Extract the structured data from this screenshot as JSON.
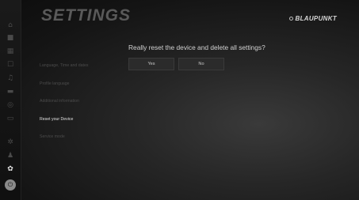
{
  "header": {
    "title": "SETTINGS",
    "brand": "BLAUPUNKT"
  },
  "sidebar": {
    "icons": [
      {
        "name": "home-icon",
        "glyph": "⌂",
        "active": false
      },
      {
        "name": "apps-icon",
        "glyph": "■",
        "active": false
      },
      {
        "name": "grid-icon",
        "glyph": "▦",
        "active": false
      },
      {
        "name": "phone-icon",
        "glyph": "☐",
        "active": false
      },
      {
        "name": "music-icon",
        "glyph": "♫",
        "active": false
      },
      {
        "name": "car-icon",
        "glyph": "▬",
        "active": false
      },
      {
        "name": "navigation-icon",
        "glyph": "◎",
        "active": false
      },
      {
        "name": "media-icon",
        "glyph": "▭",
        "active": false
      },
      {
        "name": "settings-icon",
        "glyph": "✲",
        "active": false
      },
      {
        "name": "person-icon",
        "glyph": "♟",
        "active": false
      },
      {
        "name": "active-settings-icon",
        "glyph": "✿",
        "active": true
      },
      {
        "name": "power-icon",
        "glyph": "⏻",
        "active": false
      }
    ]
  },
  "menu": {
    "items": [
      {
        "label": "Language, Time and dates",
        "active": false
      },
      {
        "label": "Profile language",
        "active": false
      },
      {
        "label": "Additional information",
        "active": false
      },
      {
        "label": "Reset your Device",
        "active": true
      },
      {
        "label": "Service mode",
        "active": false
      }
    ]
  },
  "dialog": {
    "question": "Really reset the device and delete all settings?",
    "yes_label": "Yes",
    "no_label": "No"
  }
}
